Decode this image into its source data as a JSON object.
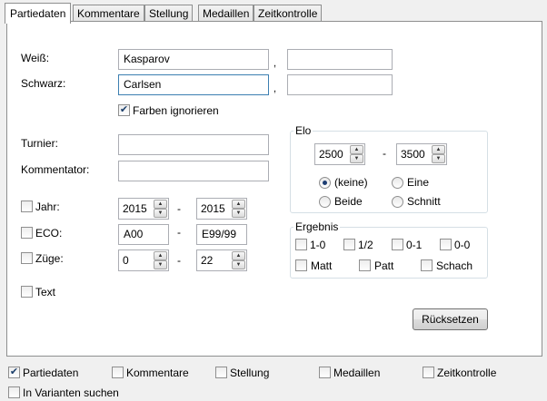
{
  "tabs": [
    "Partiedaten",
    "Kommentare",
    "Stellung",
    "Medaillen",
    "Zeitkontrolle"
  ],
  "players": {
    "white_label": "Weiß:",
    "white_value": "Kasparov",
    "white_value2": "",
    "black_label": "Schwarz:",
    "black_value": "Carlsen",
    "black_value2": "",
    "comma": ",",
    "ignore_colors_label": "Farben ignorieren",
    "ignore_colors_checked": true
  },
  "tournament": {
    "label": "Turnier:",
    "value": ""
  },
  "commentator": {
    "label": "Kommentator:",
    "value": ""
  },
  "year": {
    "label": "Jahr:",
    "checked": false,
    "from": "2015",
    "to": "2015"
  },
  "eco": {
    "label": "ECO:",
    "checked": false,
    "from": "A00",
    "to": "E99/99"
  },
  "moves": {
    "label": "Züge:",
    "checked": false,
    "from": "0",
    "to": "22"
  },
  "text": {
    "label": "Text",
    "checked": false
  },
  "dash": "-",
  "elo": {
    "title": "Elo",
    "from": "2500",
    "to": "3500",
    "options": {
      "none": "(keine)",
      "one": "Eine",
      "both": "Beide",
      "average": "Schnitt"
    },
    "selected": "none"
  },
  "result": {
    "title": "Ergebnis",
    "options": [
      "1-0",
      "1/2",
      "0-1",
      "0-0"
    ],
    "types": [
      "Matt",
      "Patt",
      "Schach"
    ]
  },
  "reset_label": "Rücksetzen",
  "footer": {
    "checks": [
      {
        "label": "Partiedaten",
        "checked": true
      },
      {
        "label": "Kommentare",
        "checked": false
      },
      {
        "label": "Stellung",
        "checked": false
      },
      {
        "label": "Medaillen",
        "checked": false
      },
      {
        "label": "Zeitkontrolle",
        "checked": false
      }
    ],
    "variants_label": "In Varianten suchen",
    "variants_checked": false
  },
  "check_mark": "✔",
  "spin_up": "▲",
  "spin_down": "▼"
}
